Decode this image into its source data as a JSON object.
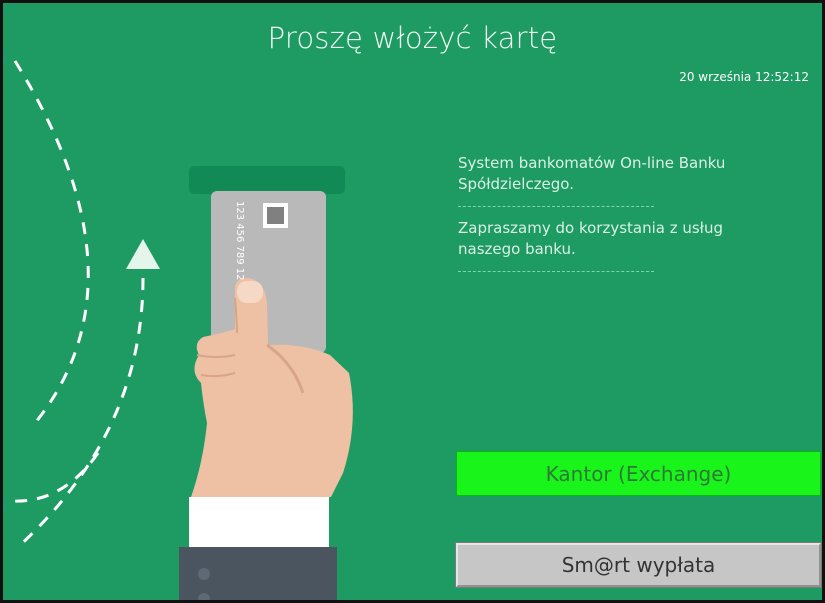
{
  "header": {
    "title": "Proszę włożyć kartę",
    "datetime": "20 września 12:52:12"
  },
  "info": {
    "line1": "System bankomatów On-line Banku Spółdzielczego.",
    "line2": "Zapraszamy do korzystania z usług naszego banku."
  },
  "card": {
    "number": "123 456 789 12"
  },
  "buttons": {
    "exchange": "Kantor (Exchange)",
    "smart_withdrawal": "Sm@rt wypłata"
  },
  "colors": {
    "background": "#1d9b63",
    "exchange_button": "#19f51a",
    "smart_button": "#c6c6c6"
  },
  "icons": [
    "insert-arrow-icon",
    "card-slot-icon",
    "card-chip-icon"
  ]
}
